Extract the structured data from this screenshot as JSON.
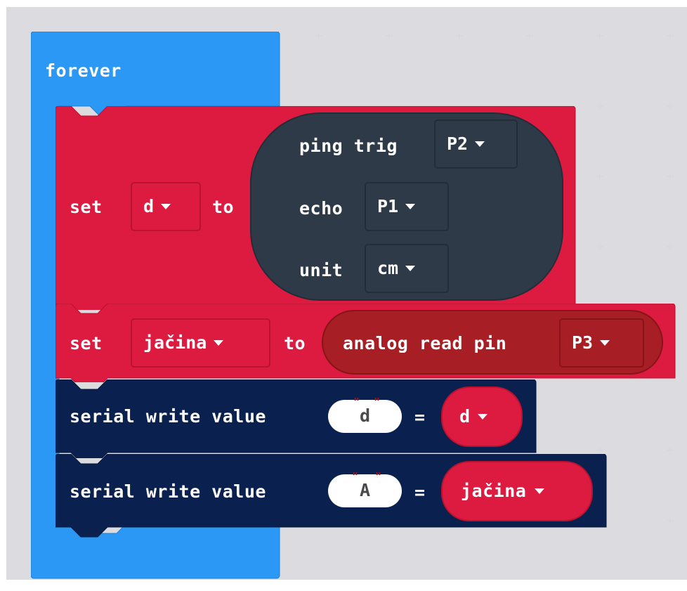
{
  "blocks": {
    "forever": {
      "label": "forever",
      "color": "#1e90ff"
    },
    "set_d": {
      "set_label": "set",
      "variable": "d",
      "to_label": "to",
      "color": "#d5173b",
      "ping": {
        "trig_label": "ping trig",
        "trig_pin": "P2",
        "echo_label": "echo",
        "echo_pin": "P1",
        "unit_label": "unit",
        "unit_value": "cm",
        "color": "#2e3b4b"
      }
    },
    "set_jacina": {
      "set_label": "set",
      "variable": "jačina",
      "to_label": "to",
      "color": "#d5173b",
      "analog": {
        "label": "analog read pin",
        "pin": "P3",
        "color": "#a71e24"
      }
    },
    "serial_1": {
      "label": "serial write value",
      "name": "d",
      "eq": "=",
      "value_var": "d",
      "color": "#00204f"
    },
    "serial_2": {
      "label": "serial write value",
      "name": "A",
      "eq": "=",
      "value_var": "jačina",
      "color": "#00204f"
    }
  },
  "icons": {
    "dropdown": "triangle-down-icon"
  }
}
